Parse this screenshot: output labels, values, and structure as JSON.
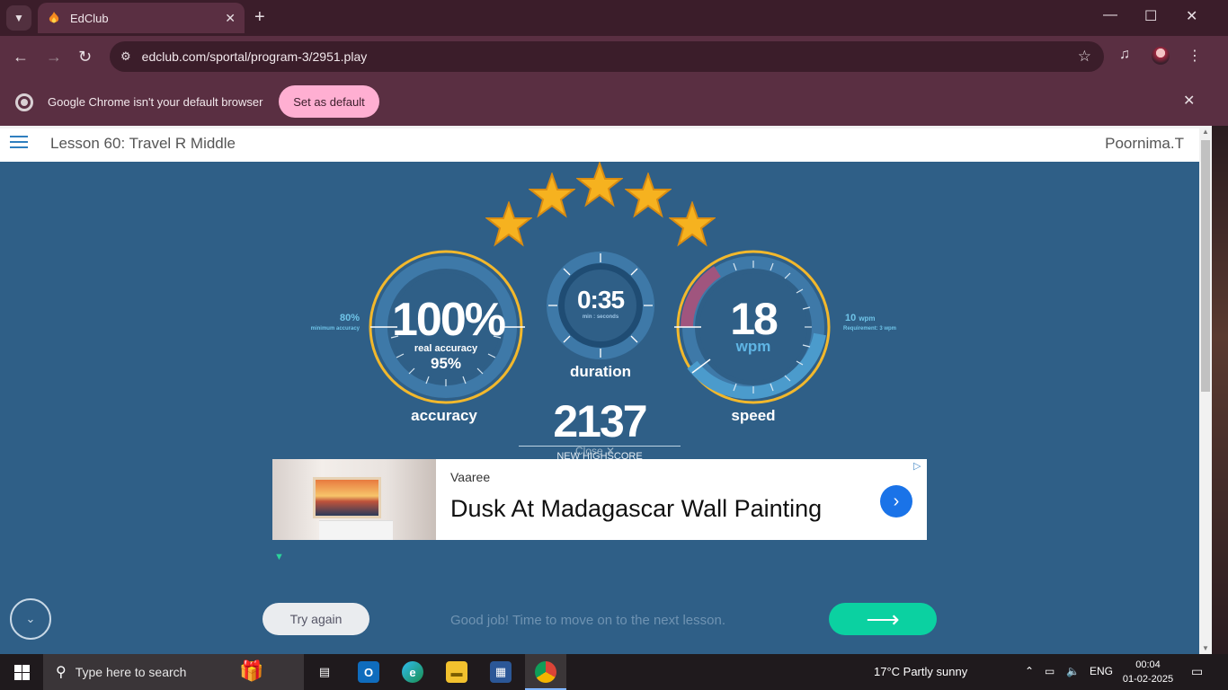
{
  "browser": {
    "tab_title": "EdClub",
    "url": "edclub.com/sportal/program-3/2951.play",
    "infobar_message": "Google Chrome isn't your default browser",
    "set_default_label": "Set as default"
  },
  "page": {
    "lesson_title": "Lesson 60: Travel R Middle",
    "user_name": "Poornima.T",
    "stars": 5,
    "accuracy": {
      "value": "100%",
      "real_label": "real accuracy",
      "real_value": "95%",
      "label": "accuracy",
      "min_value": "80%",
      "min_label": "minimum accuracy"
    },
    "duration": {
      "value": "0:35",
      "unit": "min : seconds",
      "label": "duration"
    },
    "speed": {
      "value": "18",
      "unit": "wpm",
      "label": "speed",
      "req_value": "10",
      "req_unit": "wpm",
      "req_label": "Requirement: 3 wpm"
    },
    "score": {
      "value": "2137",
      "label": "NEW HIGHSCORE",
      "close_label": "Close ✕"
    },
    "ad": {
      "brand": "Vaaree",
      "headline": "Dusk At Madagascar Wall Painting"
    },
    "try_again_label": "Try again",
    "good_job_message": "Good job! Time to move on to the next lesson.",
    "next_arrow": "⟶"
  },
  "taskbar": {
    "search_placeholder": "Type here to search",
    "weather": "17°C  Partly sunny",
    "language": "ENG",
    "time": "00:04",
    "date": "01-02-2025"
  },
  "colors": {
    "page_bg": "#2f5f87",
    "gold": "#f2b82c",
    "accent_green": "#0bd1a1",
    "chrome_frame": "#5a2f42"
  }
}
